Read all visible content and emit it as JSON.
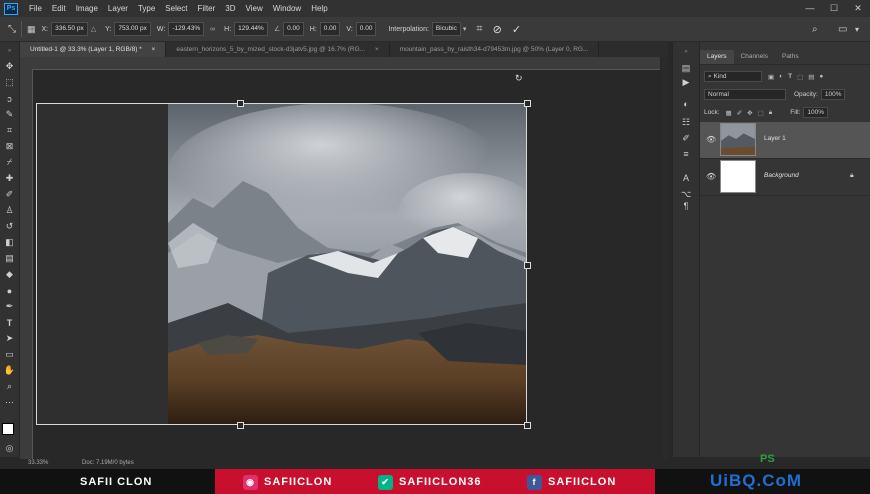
{
  "menu": {
    "app_icon": "Ps",
    "items": [
      "File",
      "Edit",
      "Image",
      "Layer",
      "Type",
      "Select",
      "Filter",
      "3D",
      "View",
      "Window",
      "Help"
    ]
  },
  "window_controls": {
    "minimize": "—",
    "maximize": "☐",
    "close": "✕"
  },
  "options_bar": {
    "x_label": "X:",
    "x_value": "336.50 px",
    "y_label": "Y:",
    "y_value": "753.00 px",
    "w_label": "W:",
    "w_value": "-129.43%",
    "h_label": "H:",
    "h_value": "129.44%",
    "angle_value": "0.00",
    "hskew_label": "H:",
    "hskew_value": "0.00",
    "vskew_label": "V:",
    "vskew_value": "0.00",
    "interp_label": "Interpolation:",
    "interp_value": "Bicubic"
  },
  "tabs": [
    {
      "label": "Untitled-1 @ 33.3% (Layer 1, RGB/8) *",
      "active": true
    },
    {
      "label": "eastern_horizons_5_by_mized_stock-d3jatv5.jpg @ 16.7% (RG...",
      "active": false
    },
    {
      "label": "mountain_pass_by_raisth34-d79453m.jpg @ 50% (Layer 0, RG...",
      "active": false
    }
  ],
  "tab_close": "×",
  "layers_panel": {
    "tabs": [
      "Layers",
      "Channels",
      "Paths"
    ],
    "kind_placeholder": "Kind",
    "blend_mode": "Normal",
    "opacity_label": "Opacity:",
    "opacity_value": "100%",
    "lock_label": "Lock:",
    "fill_label": "Fill:",
    "fill_value": "100%",
    "layers": [
      {
        "name": "Layer 1",
        "selected": true
      },
      {
        "name": "Background",
        "selected": false
      }
    ]
  },
  "status": {
    "zoom": "33.33%",
    "doc": "Doc: 7.19M/0 bytes"
  },
  "banner": {
    "brand": "SAFII CLON",
    "instagram": "SAFIICLON",
    "vine": "SAFIICLON36",
    "facebook": "SAFIICLON"
  },
  "watermark": {
    "ps": "PS",
    "brand": "UiBQ.CoM"
  },
  "colors": {
    "accent": "#31a8ff",
    "banner_red": "#c8102e"
  }
}
